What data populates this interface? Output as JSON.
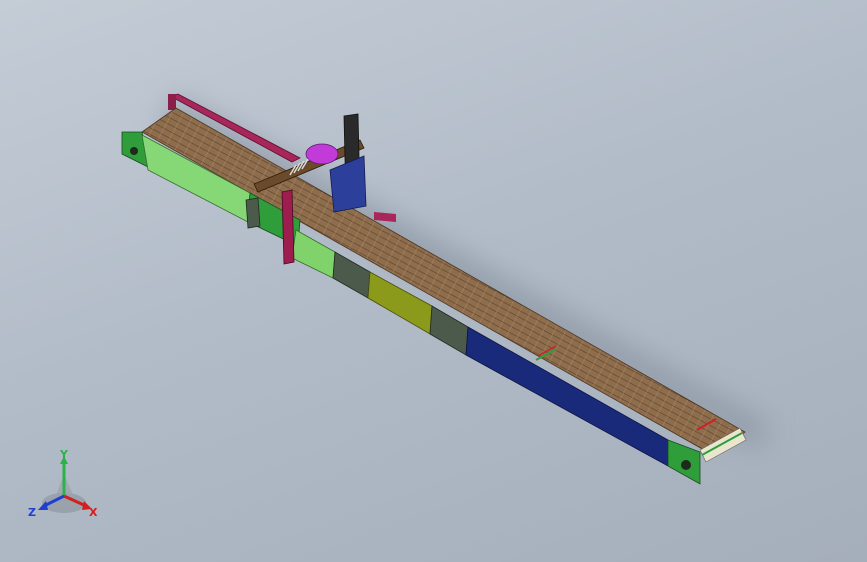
{
  "viewport": {
    "background_top": "#c4ccd6",
    "background_bottom": "#a5aebb"
  },
  "model": {
    "type": "belt-conveyor-assembly",
    "belt_color": "#8a6a4a",
    "frame_colors": [
      "#2f9d3a",
      "#7fd36a",
      "#4b5a4a",
      "#8b9a1a",
      "#1a2a7a",
      "#9c1d4e",
      "#2a2a2a"
    ],
    "accent_color": "#c23bd8"
  },
  "triad": {
    "x_label": "X",
    "y_label": "Y",
    "z_label": "Z",
    "x_color": "#d21f1f",
    "y_color": "#2bb34a",
    "z_color": "#1f3fd2"
  }
}
